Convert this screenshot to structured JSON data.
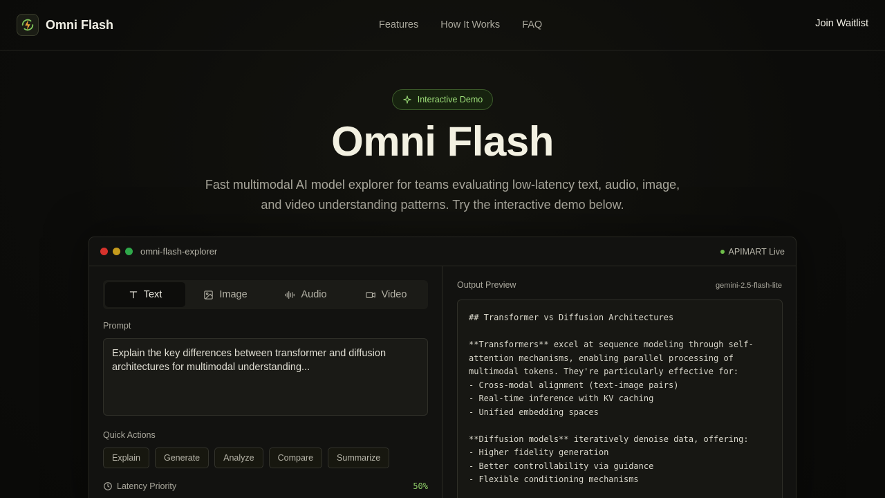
{
  "nav": {
    "brand": "Omni Flash",
    "links": [
      "Features",
      "How It Works",
      "FAQ"
    ],
    "cta": "Join Waitlist"
  },
  "hero": {
    "badge": "Interactive Demo",
    "title": "Omni Flash",
    "subtitle": "Fast multimodal AI model explorer for teams evaluating low-latency text, audio, image, and video understanding patterns. Try the interactive demo below."
  },
  "panel": {
    "title": "omni-flash-explorer",
    "status": "APIMART Live",
    "tabs": [
      "Text",
      "Image",
      "Audio",
      "Video"
    ],
    "active_tab": "Text",
    "prompt_label": "Prompt",
    "prompt_text": "Explain the key differences between transformer and diffusion architectures for multimodal understanding...",
    "quick_actions_label": "Quick Actions",
    "quick_actions": [
      "Explain",
      "Generate",
      "Analyze",
      "Compare",
      "Summarize"
    ],
    "latency_label": "Latency Priority",
    "latency_value": "50%",
    "output_label": "Output Preview",
    "model": "gemini-2.5-flash-lite",
    "output_text": "## Transformer vs Diffusion Architectures\n\n**Transformers** excel at sequence modeling through self-attention mechanisms, enabling parallel processing of multimodal tokens. They're particularly effective for:\n- Cross-modal alignment (text-image pairs)\n- Real-time inference with KV caching\n- Unified embedding spaces\n\n**Diffusion models** iteratively denoise data, offering:\n- Higher fidelity generation\n- Better controllability via guidance\n- Flexible conditioning mechanisms"
  },
  "colors": {
    "accent_green": "#9ee07a",
    "live_green": "#6fbf4a",
    "traffic_red": "#d6322c",
    "traffic_yellow": "#c49a1c",
    "traffic_green": "#2fa84a"
  }
}
